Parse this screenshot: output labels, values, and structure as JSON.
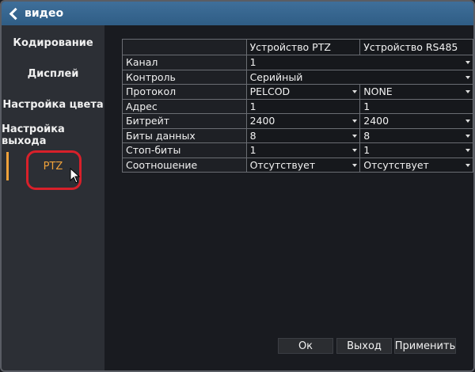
{
  "window": {
    "title": "видео"
  },
  "sidebar": {
    "items": [
      {
        "label": "Кодирование"
      },
      {
        "label": "Дисплей"
      },
      {
        "label": "Настройка цвета"
      },
      {
        "label": "Настройка выхода"
      },
      {
        "label": "PTZ"
      }
    ],
    "active": "PTZ"
  },
  "table": {
    "headers": [
      "Устройство PTZ",
      "Устройство RS485"
    ],
    "rows": [
      {
        "label": "Канал",
        "ptz": "1",
        "rs485": "",
        "merged": true
      },
      {
        "label": "Контроль",
        "ptz": "Серийный",
        "rs485": "",
        "merged": true
      },
      {
        "label": "Протокол",
        "ptz": "PELCOD",
        "rs485": "NONE"
      },
      {
        "label": "Адрес",
        "ptz": "1",
        "rs485": "1"
      },
      {
        "label": "Битрейт",
        "ptz": "2400",
        "rs485": "2400"
      },
      {
        "label": "Биты данных",
        "ptz": "8",
        "rs485": "8"
      },
      {
        "label": "Стоп-биты",
        "ptz": "1",
        "rs485": "1"
      },
      {
        "label": "Соотношение",
        "ptz": "Отсутствует",
        "rs485": "Отсутствует"
      }
    ]
  },
  "buttons": {
    "ok": "Ок",
    "exit": "Выход",
    "apply": "Применить"
  },
  "colors": {
    "accent": "#f0a23a",
    "titlebar": "#2f5d85",
    "highlight": "#d8202a"
  }
}
